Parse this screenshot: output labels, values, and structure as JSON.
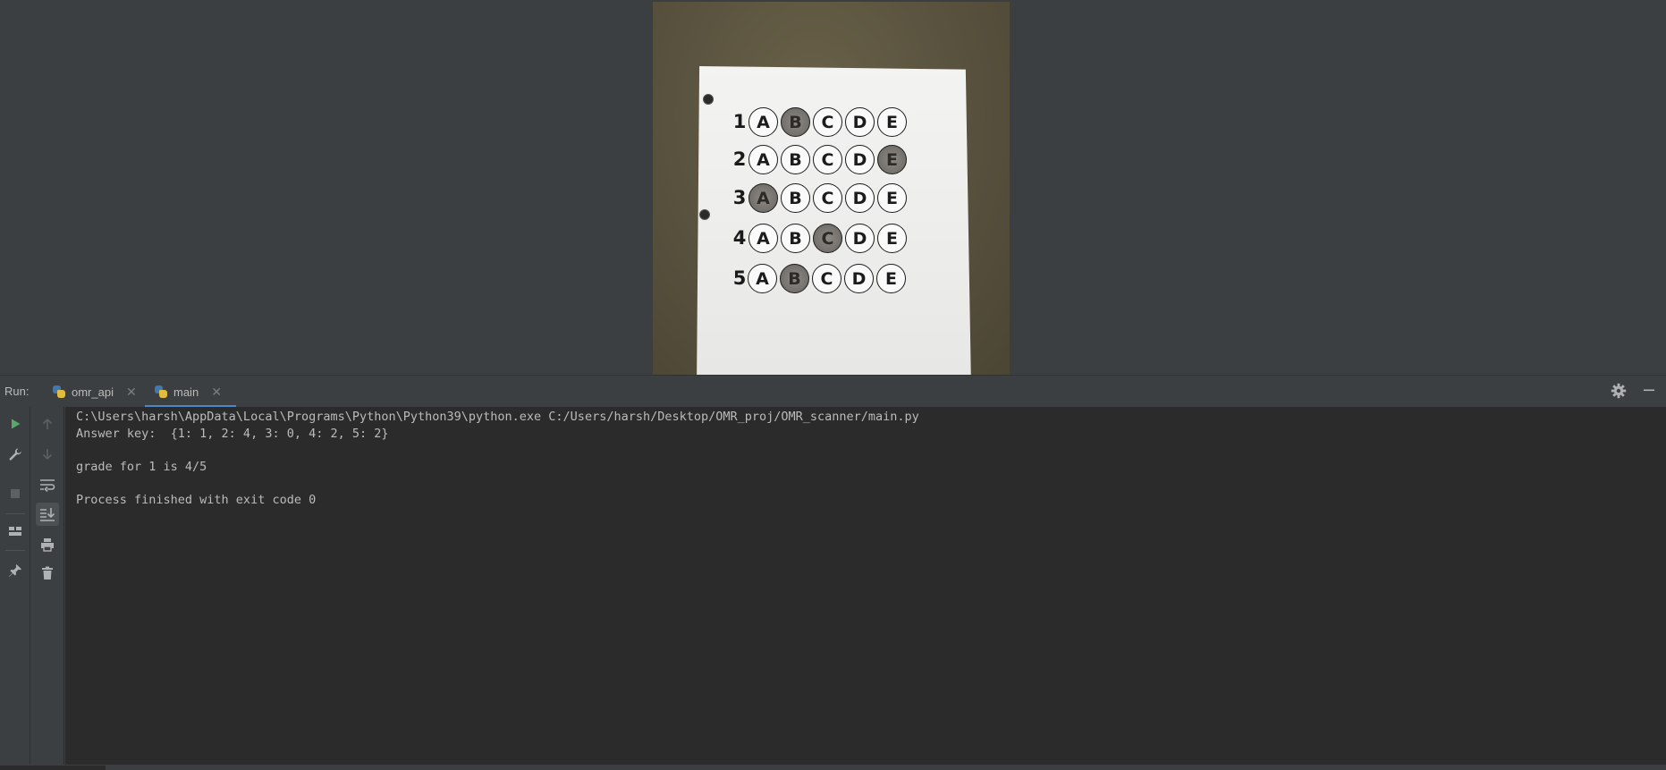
{
  "viewer": {
    "omr_sheet": {
      "rows": [
        {
          "number": "1",
          "choices": [
            "A",
            "B",
            "C",
            "D",
            "E"
          ],
          "filled": "B"
        },
        {
          "number": "2",
          "choices": [
            "A",
            "B",
            "C",
            "D",
            "E"
          ],
          "filled": "E"
        },
        {
          "number": "3",
          "choices": [
            "A",
            "B",
            "C",
            "D",
            "E"
          ],
          "filled": "A"
        },
        {
          "number": "4",
          "choices": [
            "A",
            "B",
            "C",
            "D",
            "E"
          ],
          "filled": "C"
        },
        {
          "number": "5",
          "choices": [
            "A",
            "B",
            "C",
            "D",
            "E"
          ],
          "filled": "B"
        }
      ]
    }
  },
  "run_panel": {
    "label": "Run:",
    "tabs": [
      {
        "label": "omr_api",
        "icon": "python-icon",
        "active": false
      },
      {
        "label": "main",
        "icon": "python-icon",
        "active": true
      }
    ],
    "header_actions": {
      "settings_icon": "gear-icon",
      "hide_icon": "minimize-icon"
    },
    "toolbar_left": [
      "rerun-icon",
      "wrench-icon",
      "stop-icon",
      "layout-icon",
      "pin-icon"
    ],
    "toolbar_right": [
      "up-arrow-icon",
      "down-arrow-icon",
      "soft-wrap-icon",
      "scroll-to-end-icon",
      "print-icon",
      "trash-icon"
    ],
    "console_lines": [
      "C:\\Users\\harsh\\AppData\\Local\\Programs\\Python\\Python39\\python.exe C:/Users/harsh/Desktop/OMR_proj/OMR_scanner/main.py",
      "Answer key:  {1: 1, 2: 4, 3: 0, 4: 2, 5: 2}",
      "",
      "grade for 1 is 4/5",
      "",
      "Process finished with exit code 0"
    ]
  },
  "colors": {
    "background": "#3c3f41",
    "console_bg": "#2b2b2b",
    "text": "#bbbbbb",
    "run_green": "#59a869",
    "accent": "#4a88c7"
  }
}
